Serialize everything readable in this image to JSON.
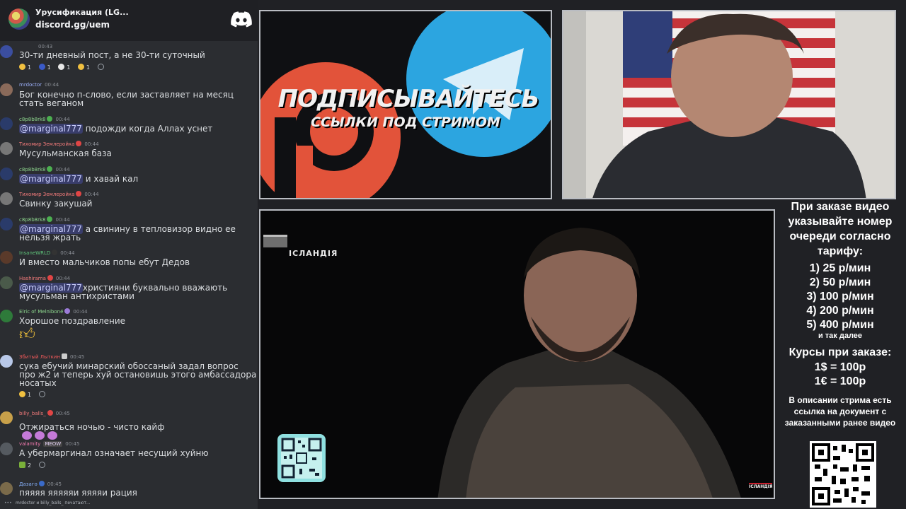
{
  "chat": {
    "server_name": "Урусификация (LG...",
    "invite": "discord.gg/uem",
    "messages": [
      {
        "user": "",
        "time": "00:43",
        "text": "30-ти дневный пост, а не 30-ти суточный",
        "reactions": [
          {
            "count": "1"
          },
          {
            "count": "1"
          },
          {
            "count": "1"
          },
          {
            "count": "1"
          }
        ]
      },
      {
        "user": "mrdoctor",
        "time": "00:44",
        "text": "Бог конечно п-слово, если заставляет на месяц стать веганом"
      },
      {
        "user": "c8p8b8rk8",
        "time": "00:44",
        "mention": "@marginal777",
        "text": "подожди когда Аллах уснет"
      },
      {
        "user": "Тихомир Землеройка",
        "time": "00:44",
        "text": "Мусульманская база"
      },
      {
        "user": "c8p8b8rk8",
        "time": "00:44",
        "mention": "@marginal777",
        "text": "и хавай кал"
      },
      {
        "user": "Тихомир Землеройка",
        "time": "00:44",
        "text": "Свинку закушай"
      },
      {
        "user": "c8p8b8rk8",
        "time": "00:44",
        "mention": "@marginal777",
        "text": "а свинину в тепловизор видно ее нельзя жрать"
      },
      {
        "user": "InsaneWRLD",
        "time": "00:44",
        "text": "И вместо мальчиков попы ебут Дедов"
      },
      {
        "user": "Hashirama",
        "time": "00:44",
        "mention": "@marginal777",
        "text": "християни буквально вважають мусульман антихристами"
      },
      {
        "user": "Elric of Melniboné",
        "time": "00:44",
        "text": "Хорошое поздравление"
      },
      {
        "user": "Збитый Лыткин",
        "time": "00:45",
        "text": "сука ебучий минарский обоссаный задал вопрос про ж2 и теперь хуй остановишь этого амбассадора носатых",
        "reactions": [
          {
            "count": "1"
          }
        ]
      },
      {
        "user": "billy_balls_",
        "time": "00:45",
        "text": "Отжираться ночью - чисто кайф"
      },
      {
        "user": "valamity",
        "time": "00:45",
        "badge": "MEOW",
        "text": "А убермаргинал означает несущий хуйню",
        "reactions": [
          {
            "count": "2"
          }
        ]
      },
      {
        "user": "Дазаго",
        "time": "00:45",
        "text": "пяяяя яяяяяи яяяяи рация"
      }
    ],
    "typing": "mrdoctor и billy_balls_ печатают..."
  },
  "promo": {
    "headline": "ПОДПИСЫВАЙТЕСЬ",
    "subline": "ССЫЛКИ ПОД СТРИМОМ"
  },
  "video": {
    "label": "ІСЛАНДІЯ",
    "watermark": "ІСЛАНДІЯ"
  },
  "info": {
    "intro": "При заказе видео указывайте номер очереди согласно тарифу:",
    "tariffs": [
      "1) 25 р/мин",
      "2) 50 р/мин",
      "3) 100 р/мин",
      "4) 200 р/мин",
      "5) 400 р/мин"
    ],
    "tariffs_more": "и так далее",
    "rates_title": "Курсы при заказе:",
    "rates": [
      "1$ = 100р",
      "1€ = 100р"
    ],
    "description_note": "В описании стрима есть ссылка на документ с заказанными ранее видео"
  },
  "colors": {
    "chat_bg": "#2b2d31",
    "mention_bg": "#5865f2",
    "patreon": "#e2533a",
    "telegram": "#2ca5e0",
    "discord": "#ffffff"
  }
}
